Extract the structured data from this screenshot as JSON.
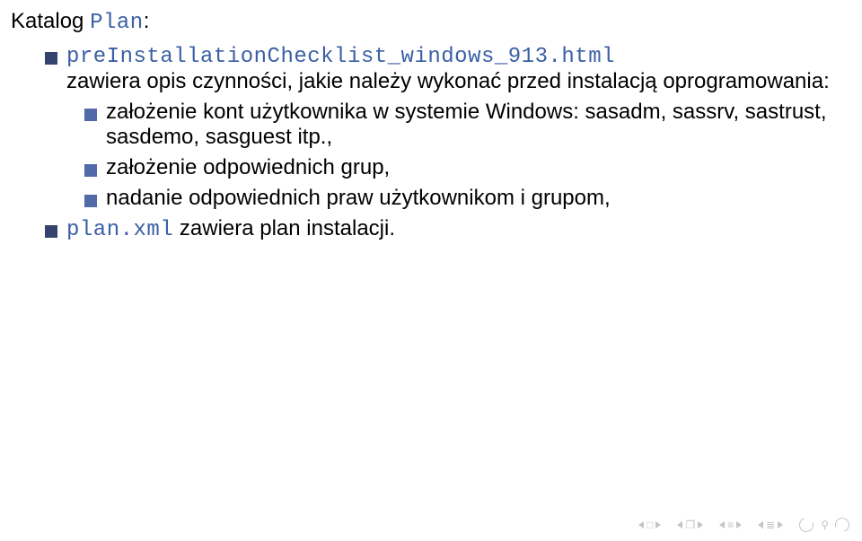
{
  "heading_prefix": "Katalog ",
  "heading_mono": "Plan",
  "heading_suffix": ":",
  "item1": {
    "mono": "preInstallationChecklist_windows_913.html",
    "text": "zawiera opis czynności, jakie należy wykonać przed instalacją oprogramowania:",
    "sub1": "założenie kont użytkownika w systemie Windows: sasadm, sassrv, sastrust, sasdemo, sasguest itp.,",
    "sub2": "założenie odpowiednich grup,",
    "sub3": "nadanie odpowiednich praw użytkownikom i grupom,"
  },
  "item2": {
    "mono": "plan.xml",
    "text": " zawiera plan instalacji."
  }
}
